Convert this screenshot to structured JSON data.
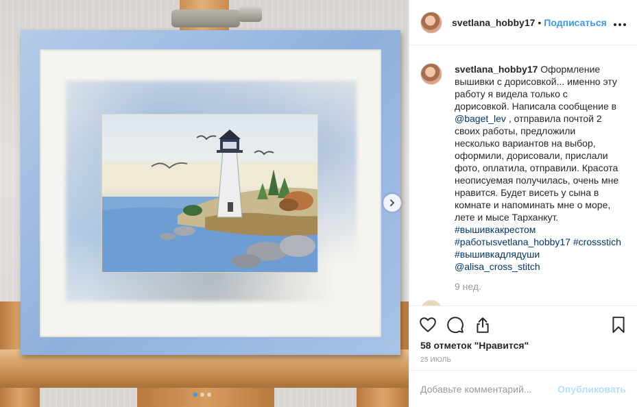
{
  "post": {
    "username": "svetlana_hobby17",
    "separator": "•",
    "follow_label": "Подписаться",
    "more_icon": "more-horizontal-icon"
  },
  "caption": {
    "username": "svetlana_hobby17",
    "text_1": "Оформление вышивки с дорисовкой... именно эту работу я видела только с дорисовкой. Написала сообщение в ",
    "mention_1": "@baget_lev",
    "text_2": " , отправила почтой 2 своих работы, предложили несколько вариантов на выбор, оформили, дорисовали, прислали фото, оплатила, отправили. Красота неописуемая получилась, очень мне нравится. Будет висеть у сына в комнате и напоминать мне о море, лете и мысе Тарханкут.",
    "hashtag_1": "#вышивкакрестом",
    "hashtag_2": "#работыsvetlana_hobby17",
    "hashtag_3": "#crossstich",
    "hashtag_4": "#вышивкадлядуши",
    "mention_2": "@alisa_cross_stitch",
    "time_ago": "9 нед."
  },
  "actions": {
    "like_icon": "heart-icon",
    "comment_icon": "comment-icon",
    "share_icon": "share-icon",
    "save_icon": "bookmark-icon"
  },
  "likes_text": "58 отметок \"Нравится\"",
  "date_text": "25 ИЮЛЬ",
  "comment": {
    "placeholder": "Добавьте комментарий...",
    "post_label": "Опубликовать"
  },
  "carousel": {
    "dots": 3,
    "active_index": 0
  },
  "colors": {
    "accent": "#3897f0",
    "link": "#003569",
    "muted": "#999999",
    "post_disabled": "#b2dffc",
    "frame": "#8fb0dc"
  }
}
